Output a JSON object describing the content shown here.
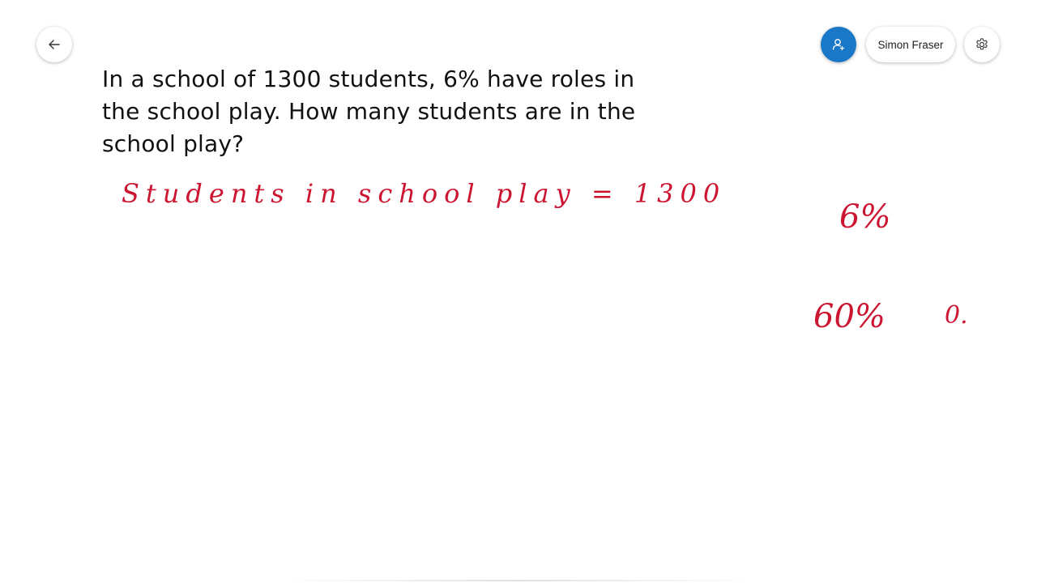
{
  "toolbar": {
    "back_icon": "arrow-left-icon",
    "invite_icon": "person-add-icon",
    "user_name": "Simon Fraser",
    "settings_icon": "gear-icon",
    "accent_color": "#1a78c8"
  },
  "canvas": {
    "problem_lines": [
      "In a school of 1300 students, 6% have roles in",
      "the school play. How many students are in the",
      "school play?"
    ],
    "ink_color": "#cc1530",
    "ink_equation": "Students in school play = 1300",
    "ink_six_percent": "6%",
    "ink_sixty_percent": "60%",
    "ink_zero_dot": "0."
  }
}
